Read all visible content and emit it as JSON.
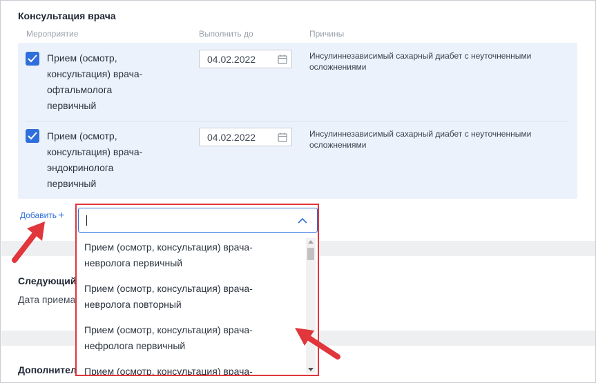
{
  "section": {
    "title": "Консультация врача",
    "columns": {
      "event": "Мероприятие",
      "due": "Выполнить до",
      "reasons": "Причины"
    }
  },
  "rows": [
    {
      "checked": true,
      "procedure_lines": [
        "Прием (осмотр,",
        "консультация) врача-",
        "офтальмолога",
        "первичный"
      ],
      "date": "04.02.2022",
      "reason_lines": [
        "Инсулиннезависимый сахарный диабет с неуточненными",
        "осложнениями"
      ]
    },
    {
      "checked": true,
      "procedure_lines": [
        "Прием (осмотр,",
        "консультация) врача-",
        "эндокринолога",
        "первичный"
      ],
      "date": "04.02.2022",
      "reason_lines": [
        "Инсулиннезависимый сахарный диабет с неуточненными",
        "осложнениями"
      ]
    }
  ],
  "add_label": "Добавить",
  "add_icon": "+",
  "background": {
    "next_title": "Следующий",
    "next_date_label": "Дата приема",
    "additional_title": "Дополнител"
  },
  "dropdown": {
    "input_value": "",
    "options": [
      {
        "line1": "Прием (осмотр, консультация) врача-",
        "line2": "невролога первичный"
      },
      {
        "line1": "Прием (осмотр, консультация) врача-",
        "line2": "невролога повторный"
      },
      {
        "line1": "Прием (осмотр, консультация) врача-",
        "line2": "нефролога первичный"
      },
      {
        "line1": "Прием (осмотр, консультация) врача-",
        "line2": ""
      }
    ]
  },
  "colors": {
    "accent": "#2f6fdb",
    "annotation": "#e0363c",
    "row_background": "#ecf2fc"
  }
}
